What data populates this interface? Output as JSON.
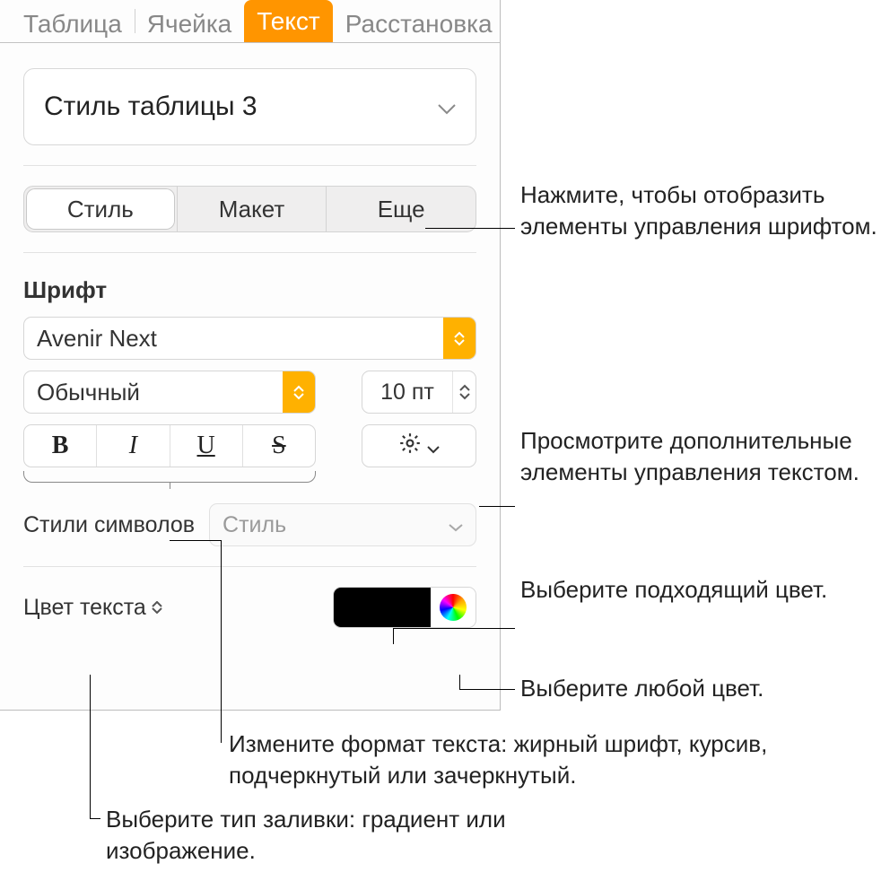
{
  "tabs": {
    "top": [
      "Таблица",
      "Ячейка",
      "Текст",
      "Расстановка"
    ],
    "active_index": 2
  },
  "style_select": {
    "value": "Стиль таблицы 3"
  },
  "seg": {
    "items": [
      "Стиль",
      "Макет",
      "Еще"
    ],
    "active_index": 0
  },
  "font": {
    "section_label": "Шрифт",
    "family": "Avenir Next",
    "weight": "Обычный",
    "size": "10 пт",
    "char_styles_label": "Стили символов",
    "char_styles_placeholder": "Стиль",
    "color_label": "Цвет текста",
    "color_hex": "#000000"
  },
  "callouts": {
    "c1": "Нажмите, чтобы отобразить элементы управления шрифтом.",
    "c2": "Просмотрите дополнительные элементы управления текстом.",
    "c3": "Выберите подходящий цвет.",
    "c4": "Выберите любой цвет.",
    "c5": "Измените формат текста: жирный шрифт, курсив, подчеркнутый или зачеркнутый.",
    "c6": "Выберите тип заливки: градиент или изображение."
  }
}
